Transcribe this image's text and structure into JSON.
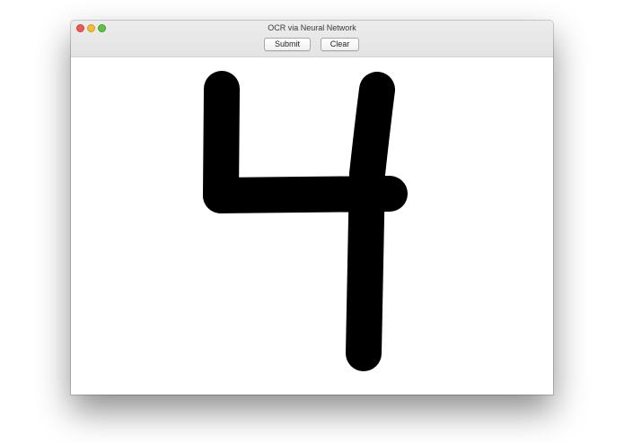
{
  "window": {
    "title": "OCR via Neural Network",
    "controls": {
      "close": "close-icon",
      "minimize": "minimize-icon",
      "zoom": "zoom-icon"
    }
  },
  "toolbar": {
    "submit_label": "Submit",
    "clear_label": "Clear"
  },
  "canvas": {
    "drawing_color": "#000000",
    "background_color": "#ffffff"
  }
}
